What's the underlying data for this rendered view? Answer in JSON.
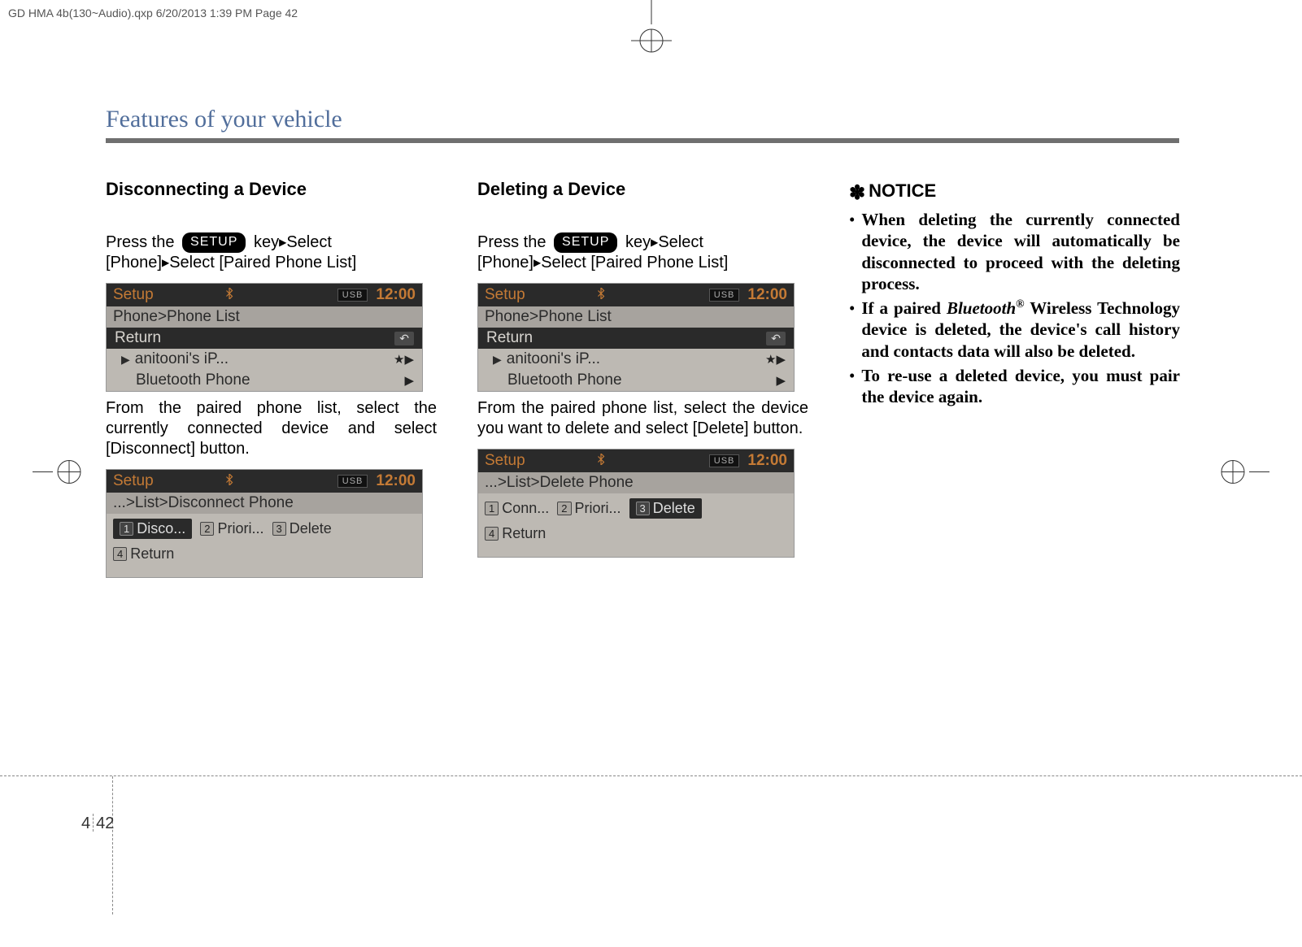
{
  "print": {
    "topline": "GD HMA 4b(130~Audio).qxp  6/20/2013  1:39 PM  Page 42"
  },
  "header": {
    "section_title": "Features of your vehicle"
  },
  "col1": {
    "heading": "Disconnecting a Device",
    "press_the": "Press  the",
    "setup_key": "SETUP",
    "key_select": "key",
    "line2": "[Phone]",
    "line2b": "Select [Paired Phone List]",
    "caption": "From the paired phone list, select the currently connected device and select [Disconnect] button.",
    "lcd1": {
      "setup": "Setup",
      "usb": "USB",
      "clock": "12:00",
      "crumb": "Phone>Phone List",
      "return": "Return",
      "row1": "anitooni's iP...",
      "row1_icon": "★▶",
      "row2": "Bluetooth Phone",
      "row2_icon": "▶"
    },
    "lcd2": {
      "setup": "Setup",
      "usb": "USB",
      "clock": "12:00",
      "crumb": "...>List>Disconnect Phone",
      "soft1": "Disco...",
      "soft2": "Priori...",
      "soft3": "Delete",
      "soft4": "Return"
    }
  },
  "col2": {
    "heading": "Deleting a Device",
    "press_the": "Press  the",
    "setup_key": "SETUP",
    "key_select": "key",
    "line2": "[Phone]",
    "line2b": "Select [Paired Phone List]",
    "caption": "From the paired phone list, select the device you want to delete and select [Delete] button.",
    "lcd1": {
      "setup": "Setup",
      "usb": "USB",
      "clock": "12:00",
      "crumb": "Phone>Phone List",
      "return": "Return",
      "row1": "anitooni's iP...",
      "row1_icon": "★▶",
      "row2": "Bluetooth Phone",
      "row2_icon": "▶"
    },
    "lcd2": {
      "setup": "Setup",
      "usb": "USB",
      "clock": "12:00",
      "crumb": "...>List>Delete Phone",
      "soft1": "Conn...",
      "soft2": "Priori...",
      "soft3": "Delete",
      "soft4": "Return"
    }
  },
  "col3": {
    "notice_label": "NOTICE",
    "items": [
      "When deleting the currently connected device, the device will automatically be disconnected to proceed with the deleting process.",
      "If a paired <em>Bluetooth</em><span class=\"reg\">®</span>  Wireless Technology device is deleted, the device's call history and contacts data will also be deleted.",
      "To re-use a deleted device, you must pair the device again."
    ]
  },
  "footer": {
    "chapter": "4",
    "page": "42"
  }
}
